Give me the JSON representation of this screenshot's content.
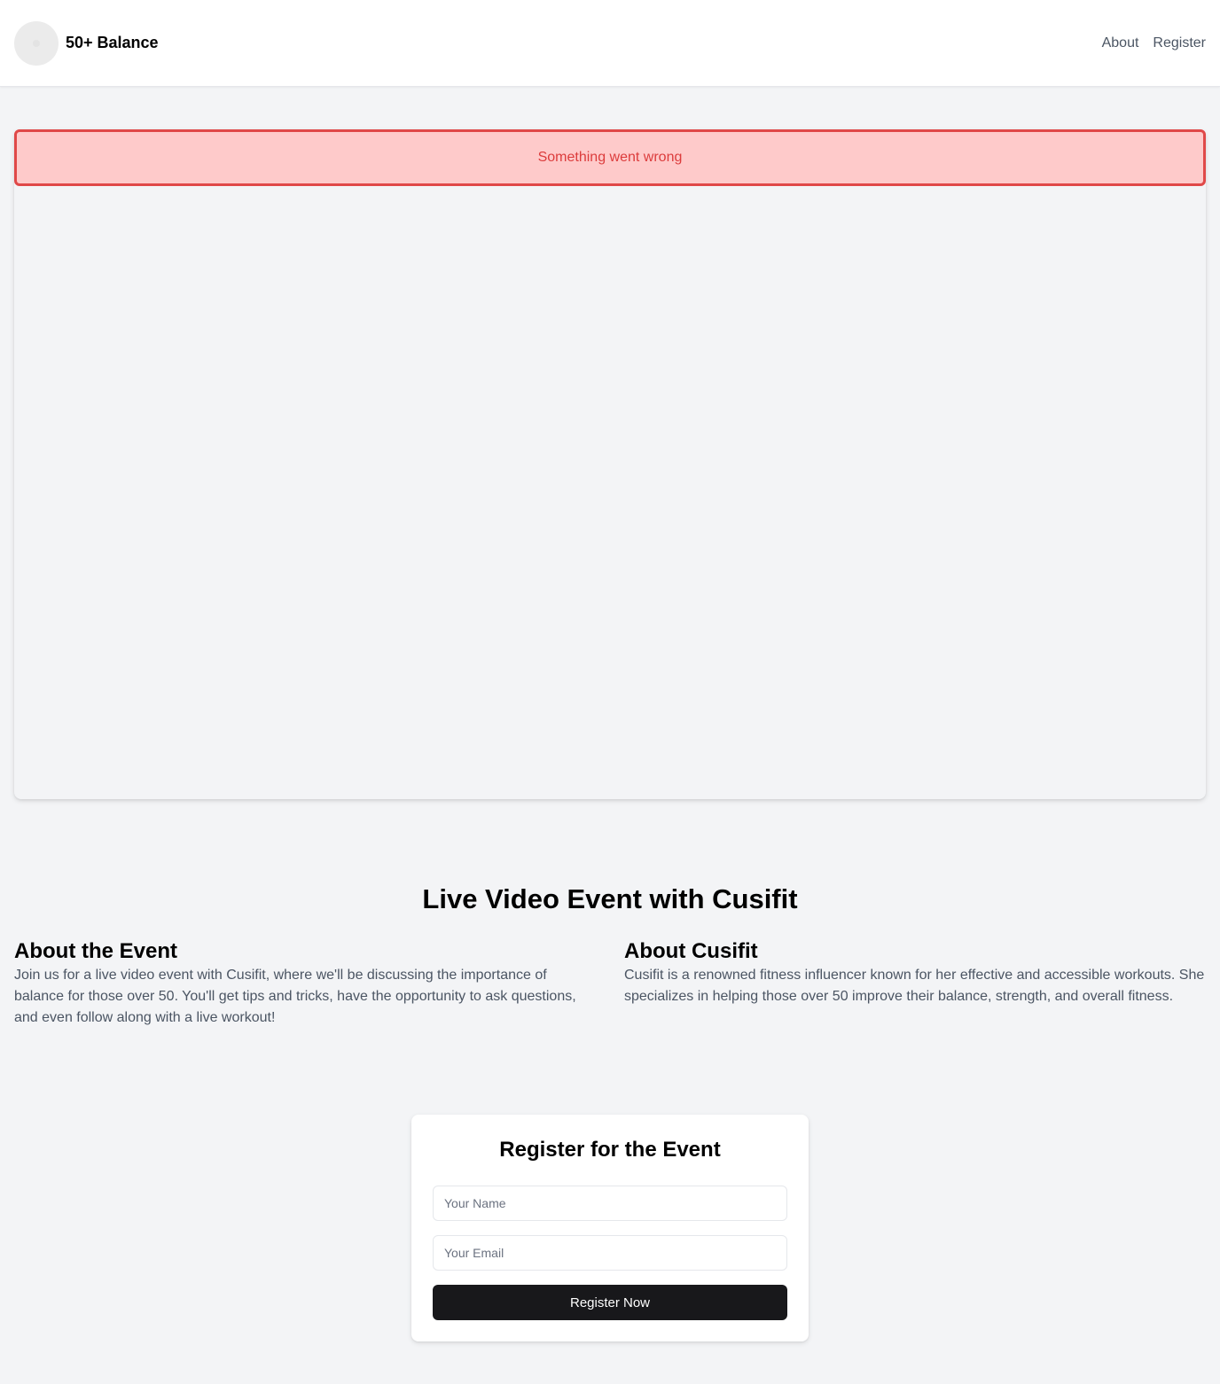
{
  "header": {
    "brand": "50+ Balance",
    "nav": [
      {
        "label": "About"
      },
      {
        "label": "Register"
      }
    ]
  },
  "video": {
    "error_message": "Something went wrong"
  },
  "event": {
    "title": "Live Video Event with Cusifit",
    "about_event": {
      "heading": "About the Event",
      "body": "Join us for a live video event with Cusifit, where we'll be discussing the importance of balance for those over 50. You'll get tips and tricks, have the opportunity to ask questions, and even follow along with a live workout!"
    },
    "about_host": {
      "heading": "About Cusifit",
      "body": "Cusifit is a renowned fitness influencer known for her effective and accessible workouts. She specializes in helping those over 50 improve their balance, strength, and overall fitness."
    }
  },
  "register": {
    "title": "Register for the Event",
    "name_placeholder": "Your Name",
    "name_value": "",
    "email_placeholder": "Your Email",
    "email_value": "",
    "submit_label": "Register Now"
  },
  "colors": {
    "error_background": "#fecaca",
    "error_border": "#e04848",
    "error_text": "#dc3c3c",
    "button_background": "#18181b"
  }
}
